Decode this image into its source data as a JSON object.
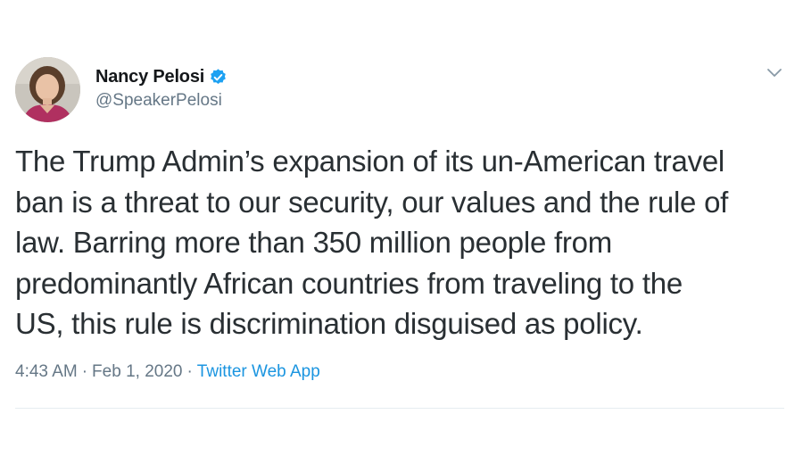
{
  "tweet": {
    "author": {
      "name": "Nancy Pelosi",
      "handle": "@SpeakerPelosi",
      "verified": true
    },
    "text_lines": [
      "The Trump Admin’s expansion of its un-American travel",
      "ban is a threat to our security, our values and the rule of",
      "law. Barring more than 350 million people from",
      "predominantly African countries from traveling to the",
      "US, this rule is discrimination disguised as policy."
    ],
    "time": "4:43 AM",
    "separator": "·",
    "date": "Feb 1, 2020",
    "source": "Twitter Web App"
  },
  "icons": {
    "verified": "verified-badge-icon",
    "menu": "chevron-down-icon"
  },
  "colors": {
    "name": "#14171a",
    "secondary": "#657786",
    "body_text": "#292f33",
    "link": "#1b95e0",
    "verified": "#1da1f2",
    "divider": "#e6ecf0"
  }
}
